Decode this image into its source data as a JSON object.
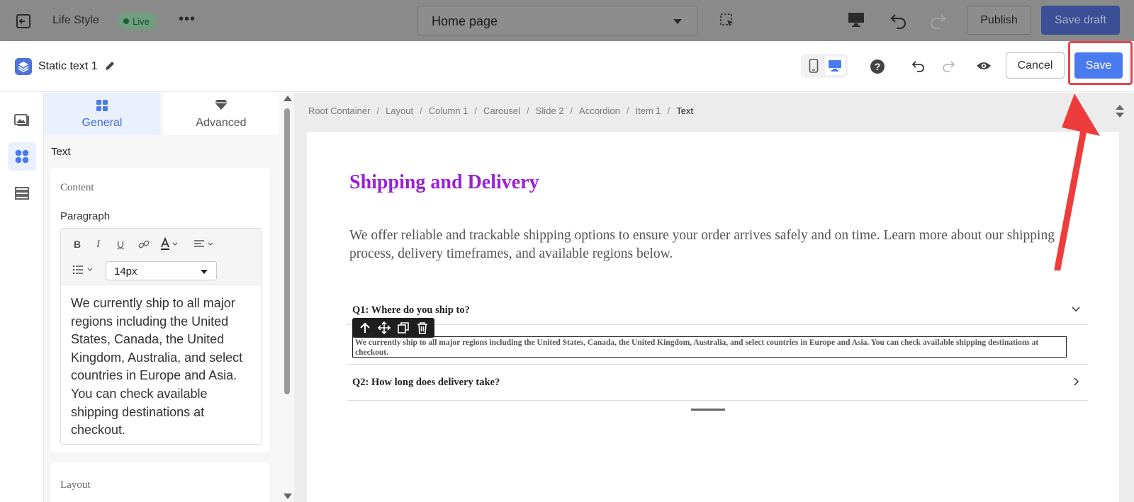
{
  "app": {
    "site_name": "Life Style",
    "live_label": "Live",
    "page_selector": "Home page",
    "publish_label": "Publish",
    "save_draft_label": "Save draft"
  },
  "modal": {
    "title": "Static text 1",
    "cancel_label": "Cancel",
    "save_label": "Save"
  },
  "panel": {
    "tabs": [
      {
        "label": "General",
        "active": true
      },
      {
        "label": "Advanced",
        "active": false
      }
    ],
    "section_label": "Text",
    "content_label": "Content",
    "paragraph_label": "Paragraph",
    "toolbar": {
      "bold": "B",
      "italic": "I",
      "underline": "U",
      "font_size": "14px"
    },
    "editor_text": "We currently ship to all major regions including the United States, Canada, the United Kingdom, Australia, and select countries in Europe and Asia. You can check available shipping destinations at checkout.",
    "layout_label": "Layout"
  },
  "breadcrumb": [
    "Root Container",
    "Layout",
    "Column 1",
    "Carousel",
    "Slide 2",
    "Accordion",
    "Item 1",
    "Text"
  ],
  "page": {
    "heading": "Shipping and Delivery",
    "intro": "We offer reliable and trackable shipping options to ensure your order arrives safely and on time. Learn more about our shipping process, delivery timeframes, and available regions below.",
    "faq": [
      {
        "question": "Q1: Where do you ship to?",
        "expanded": true,
        "answer": "We currently ship to all major regions including the United States, Canada, the United Kingdom, Australia, and select countries in Europe and Asia. You can check available shipping destinations at checkout."
      },
      {
        "question": "Q2: How long does delivery take?",
        "expanded": false
      }
    ]
  },
  "colors": {
    "accent": "#4a7af0",
    "heading": "#9b1fd8",
    "highlight": "#e8434a"
  }
}
